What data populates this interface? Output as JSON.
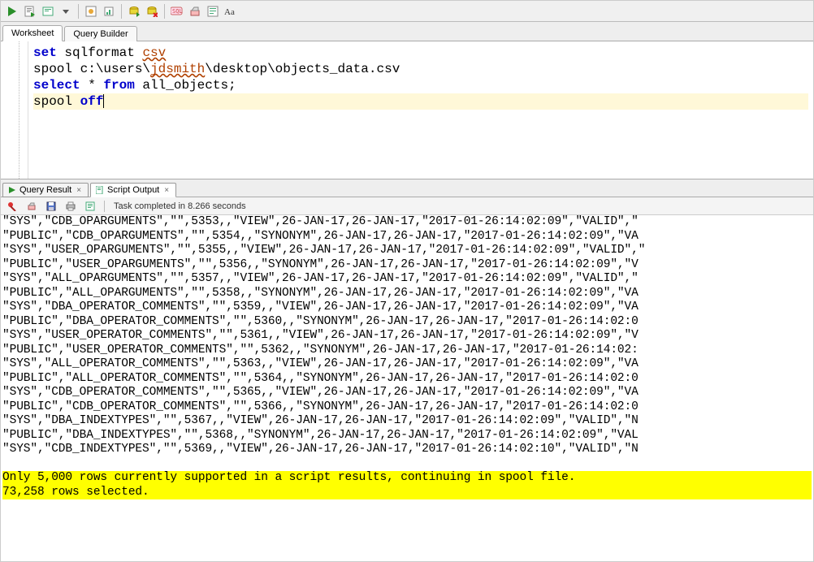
{
  "toolbar": {
    "icons": [
      "run-icon",
      "run-script-icon",
      "explain-icon",
      "autotrace-icon",
      "sql-tuning-icon",
      "commit-icon",
      "rollback-icon",
      "unshared-icon",
      "sql-history-icon",
      "clear-icon",
      "to-upper-icon"
    ]
  },
  "worksheet_tabs": {
    "worksheet": "Worksheet",
    "query_builder": "Query Builder"
  },
  "editor": {
    "line1_kw": "set",
    "line1_rest_a": " sqlformat ",
    "line1_sp": "csv",
    "line2_a": "spool c:\\users\\",
    "line2_sp": "jdsmith",
    "line2_b": "\\desktop\\objects_data.csv",
    "line3_kw1": "select",
    "line3_mid": " * ",
    "line3_kw2": "from",
    "line3_rest": " all_objects;",
    "line4_a": "spool ",
    "line4_kw": "off"
  },
  "result_tabs": {
    "query_result": "Query Result",
    "script_output": "Script Output"
  },
  "output_toolbar": {
    "status": "Task completed in 8.266 seconds"
  },
  "output_rows": [
    "\"SYS\",\"CDB_OPARGUMENTS\",\"\",5353,,\"VIEW\",26-JAN-17,26-JAN-17,\"2017-01-26:14:02:09\",\"VALID\",\"",
    "\"PUBLIC\",\"CDB_OPARGUMENTS\",\"\",5354,,\"SYNONYM\",26-JAN-17,26-JAN-17,\"2017-01-26:14:02:09\",\"VA",
    "\"SYS\",\"USER_OPARGUMENTS\",\"\",5355,,\"VIEW\",26-JAN-17,26-JAN-17,\"2017-01-26:14:02:09\",\"VALID\",\"",
    "\"PUBLIC\",\"USER_OPARGUMENTS\",\"\",5356,,\"SYNONYM\",26-JAN-17,26-JAN-17,\"2017-01-26:14:02:09\",\"V",
    "\"SYS\",\"ALL_OPARGUMENTS\",\"\",5357,,\"VIEW\",26-JAN-17,26-JAN-17,\"2017-01-26:14:02:09\",\"VALID\",\"",
    "\"PUBLIC\",\"ALL_OPARGUMENTS\",\"\",5358,,\"SYNONYM\",26-JAN-17,26-JAN-17,\"2017-01-26:14:02:09\",\"VA",
    "\"SYS\",\"DBA_OPERATOR_COMMENTS\",\"\",5359,,\"VIEW\",26-JAN-17,26-JAN-17,\"2017-01-26:14:02:09\",\"VA",
    "\"PUBLIC\",\"DBA_OPERATOR_COMMENTS\",\"\",5360,,\"SYNONYM\",26-JAN-17,26-JAN-17,\"2017-01-26:14:02:0",
    "\"SYS\",\"USER_OPERATOR_COMMENTS\",\"\",5361,,\"VIEW\",26-JAN-17,26-JAN-17,\"2017-01-26:14:02:09\",\"V",
    "\"PUBLIC\",\"USER_OPERATOR_COMMENTS\",\"\",5362,,\"SYNONYM\",26-JAN-17,26-JAN-17,\"2017-01-26:14:02:",
    "\"SYS\",\"ALL_OPERATOR_COMMENTS\",\"\",5363,,\"VIEW\",26-JAN-17,26-JAN-17,\"2017-01-26:14:02:09\",\"VA",
    "\"PUBLIC\",\"ALL_OPERATOR_COMMENTS\",\"\",5364,,\"SYNONYM\",26-JAN-17,26-JAN-17,\"2017-01-26:14:02:0",
    "\"SYS\",\"CDB_OPERATOR_COMMENTS\",\"\",5365,,\"VIEW\",26-JAN-17,26-JAN-17,\"2017-01-26:14:02:09\",\"VA",
    "\"PUBLIC\",\"CDB_OPERATOR_COMMENTS\",\"\",5366,,\"SYNONYM\",26-JAN-17,26-JAN-17,\"2017-01-26:14:02:0",
    "\"SYS\",\"DBA_INDEXTYPES\",\"\",5367,,\"VIEW\",26-JAN-17,26-JAN-17,\"2017-01-26:14:02:09\",\"VALID\",\"N",
    "\"PUBLIC\",\"DBA_INDEXTYPES\",\"\",5368,,\"SYNONYM\",26-JAN-17,26-JAN-17,\"2017-01-26:14:02:09\",\"VAL",
    "\"SYS\",\"CDB_INDEXTYPES\",\"\",5369,,\"VIEW\",26-JAN-17,26-JAN-17,\"2017-01-26:14:02:10\",\"VALID\",\"N",
    "",
    "Only 5,000 rows currently supported in a script results, continuing in spool file.",
    "73,258 rows selected."
  ]
}
